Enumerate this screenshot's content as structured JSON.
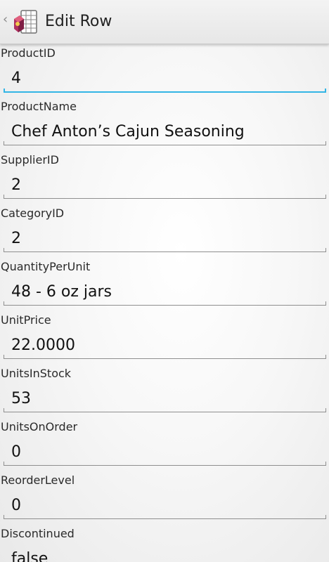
{
  "header": {
    "title": "Edit Row"
  },
  "fields": [
    {
      "label": "ProductID",
      "value": "4"
    },
    {
      "label": "ProductName",
      "value": "Chef Anton’s Cajun Seasoning"
    },
    {
      "label": "SupplierID",
      "value": "2"
    },
    {
      "label": "CategoryID",
      "value": "2"
    },
    {
      "label": "QuantityPerUnit",
      "value": "48 - 6 oz jars"
    },
    {
      "label": "UnitPrice",
      "value": "22.0000"
    },
    {
      "label": "UnitsInStock",
      "value": "53"
    },
    {
      "label": "UnitsOnOrder",
      "value": "0"
    },
    {
      "label": "ReorderLevel",
      "value": "0"
    },
    {
      "label": "Discontinued",
      "value": "false"
    }
  ],
  "colors": {
    "focus_accent": "#33b5e5",
    "underline": "#8f8f8f"
  },
  "icons": {
    "up": "chevron-left-icon",
    "app": "database-table-icon"
  }
}
